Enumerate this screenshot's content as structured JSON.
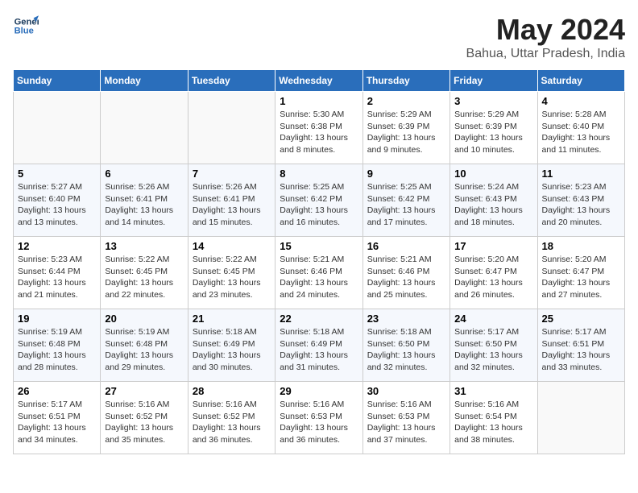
{
  "logo": {
    "line1": "General",
    "line2": "Blue"
  },
  "title": "May 2024",
  "location": "Bahua, Uttar Pradesh, India",
  "weekdays": [
    "Sunday",
    "Monday",
    "Tuesday",
    "Wednesday",
    "Thursday",
    "Friday",
    "Saturday"
  ],
  "weeks": [
    [
      {
        "day": "",
        "info": ""
      },
      {
        "day": "",
        "info": ""
      },
      {
        "day": "",
        "info": ""
      },
      {
        "day": "1",
        "info": "Sunrise: 5:30 AM\nSunset: 6:38 PM\nDaylight: 13 hours\nand 8 minutes."
      },
      {
        "day": "2",
        "info": "Sunrise: 5:29 AM\nSunset: 6:39 PM\nDaylight: 13 hours\nand 9 minutes."
      },
      {
        "day": "3",
        "info": "Sunrise: 5:29 AM\nSunset: 6:39 PM\nDaylight: 13 hours\nand 10 minutes."
      },
      {
        "day": "4",
        "info": "Sunrise: 5:28 AM\nSunset: 6:40 PM\nDaylight: 13 hours\nand 11 minutes."
      }
    ],
    [
      {
        "day": "5",
        "info": "Sunrise: 5:27 AM\nSunset: 6:40 PM\nDaylight: 13 hours\nand 13 minutes."
      },
      {
        "day": "6",
        "info": "Sunrise: 5:26 AM\nSunset: 6:41 PM\nDaylight: 13 hours\nand 14 minutes."
      },
      {
        "day": "7",
        "info": "Sunrise: 5:26 AM\nSunset: 6:41 PM\nDaylight: 13 hours\nand 15 minutes."
      },
      {
        "day": "8",
        "info": "Sunrise: 5:25 AM\nSunset: 6:42 PM\nDaylight: 13 hours\nand 16 minutes."
      },
      {
        "day": "9",
        "info": "Sunrise: 5:25 AM\nSunset: 6:42 PM\nDaylight: 13 hours\nand 17 minutes."
      },
      {
        "day": "10",
        "info": "Sunrise: 5:24 AM\nSunset: 6:43 PM\nDaylight: 13 hours\nand 18 minutes."
      },
      {
        "day": "11",
        "info": "Sunrise: 5:23 AM\nSunset: 6:43 PM\nDaylight: 13 hours\nand 20 minutes."
      }
    ],
    [
      {
        "day": "12",
        "info": "Sunrise: 5:23 AM\nSunset: 6:44 PM\nDaylight: 13 hours\nand 21 minutes."
      },
      {
        "day": "13",
        "info": "Sunrise: 5:22 AM\nSunset: 6:45 PM\nDaylight: 13 hours\nand 22 minutes."
      },
      {
        "day": "14",
        "info": "Sunrise: 5:22 AM\nSunset: 6:45 PM\nDaylight: 13 hours\nand 23 minutes."
      },
      {
        "day": "15",
        "info": "Sunrise: 5:21 AM\nSunset: 6:46 PM\nDaylight: 13 hours\nand 24 minutes."
      },
      {
        "day": "16",
        "info": "Sunrise: 5:21 AM\nSunset: 6:46 PM\nDaylight: 13 hours\nand 25 minutes."
      },
      {
        "day": "17",
        "info": "Sunrise: 5:20 AM\nSunset: 6:47 PM\nDaylight: 13 hours\nand 26 minutes."
      },
      {
        "day": "18",
        "info": "Sunrise: 5:20 AM\nSunset: 6:47 PM\nDaylight: 13 hours\nand 27 minutes."
      }
    ],
    [
      {
        "day": "19",
        "info": "Sunrise: 5:19 AM\nSunset: 6:48 PM\nDaylight: 13 hours\nand 28 minutes."
      },
      {
        "day": "20",
        "info": "Sunrise: 5:19 AM\nSunset: 6:48 PM\nDaylight: 13 hours\nand 29 minutes."
      },
      {
        "day": "21",
        "info": "Sunrise: 5:18 AM\nSunset: 6:49 PM\nDaylight: 13 hours\nand 30 minutes."
      },
      {
        "day": "22",
        "info": "Sunrise: 5:18 AM\nSunset: 6:49 PM\nDaylight: 13 hours\nand 31 minutes."
      },
      {
        "day": "23",
        "info": "Sunrise: 5:18 AM\nSunset: 6:50 PM\nDaylight: 13 hours\nand 32 minutes."
      },
      {
        "day": "24",
        "info": "Sunrise: 5:17 AM\nSunset: 6:50 PM\nDaylight: 13 hours\nand 32 minutes."
      },
      {
        "day": "25",
        "info": "Sunrise: 5:17 AM\nSunset: 6:51 PM\nDaylight: 13 hours\nand 33 minutes."
      }
    ],
    [
      {
        "day": "26",
        "info": "Sunrise: 5:17 AM\nSunset: 6:51 PM\nDaylight: 13 hours\nand 34 minutes."
      },
      {
        "day": "27",
        "info": "Sunrise: 5:16 AM\nSunset: 6:52 PM\nDaylight: 13 hours\nand 35 minutes."
      },
      {
        "day": "28",
        "info": "Sunrise: 5:16 AM\nSunset: 6:52 PM\nDaylight: 13 hours\nand 36 minutes."
      },
      {
        "day": "29",
        "info": "Sunrise: 5:16 AM\nSunset: 6:53 PM\nDaylight: 13 hours\nand 36 minutes."
      },
      {
        "day": "30",
        "info": "Sunrise: 5:16 AM\nSunset: 6:53 PM\nDaylight: 13 hours\nand 37 minutes."
      },
      {
        "day": "31",
        "info": "Sunrise: 5:16 AM\nSunset: 6:54 PM\nDaylight: 13 hours\nand 38 minutes."
      },
      {
        "day": "",
        "info": ""
      }
    ]
  ]
}
